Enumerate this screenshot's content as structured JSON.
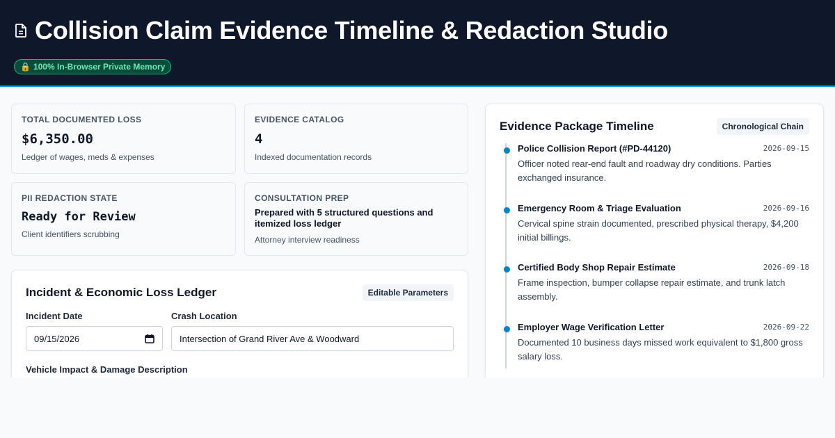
{
  "header": {
    "title": "Collision Claim Evidence Timeline & Redaction Studio",
    "privacy_badge": "100% In-Browser Private Memory",
    "privacy_icon": "🔒"
  },
  "metrics": {
    "total_loss": {
      "label": "TOTAL DOCUMENTED LOSS",
      "value": "$6,350.00",
      "sub": "Ledger of wages, meds & expenses"
    },
    "evidence_catalog": {
      "label": "EVIDENCE CATALOG",
      "value": "4",
      "sub": "Indexed documentation records"
    },
    "pii_state": {
      "label": "PII REDACTION STATE",
      "value": "Ready for Review",
      "sub": "Client identifiers scrubbing"
    },
    "consultation": {
      "label": "CONSULTATION PREP",
      "value": "Prepared with 5 structured questions and itemized loss ledger",
      "sub": "Attorney interview readiness"
    }
  },
  "ledger": {
    "title": "Incident & Economic Loss Ledger",
    "tag": "Editable Parameters",
    "incident_date_label": "Incident Date",
    "incident_date_value": "09/15/2026",
    "crash_location_label": "Crash Location",
    "crash_location_value": "Intersection of Grand River Ave & Woodward",
    "damage_label": "Vehicle Impact & Damage Description"
  },
  "timeline": {
    "title": "Evidence Package Timeline",
    "tag": "Chronological Chain",
    "items": [
      {
        "title": "Police Collision Report (#PD-44120)",
        "date": "2026-09-15",
        "desc": "Officer noted rear-end fault and roadway dry conditions. Parties exchanged insurance."
      },
      {
        "title": "Emergency Room & Triage Evaluation",
        "date": "2026-09-16",
        "desc": "Cervical spine strain documented, prescribed physical therapy, $4,200 initial billings."
      },
      {
        "title": "Certified Body Shop Repair Estimate",
        "date": "2026-09-18",
        "desc": "Frame inspection, bumper collapse repair estimate, and trunk latch assembly."
      },
      {
        "title": "Employer Wage Verification Letter",
        "date": "2026-09-22",
        "desc": "Documented 10 business days missed work equivalent to $1,800 gross salary loss."
      }
    ]
  },
  "colors": {
    "header_bg": "#0f172a",
    "accent": "#0284c7",
    "badge_green": "#10b981"
  }
}
